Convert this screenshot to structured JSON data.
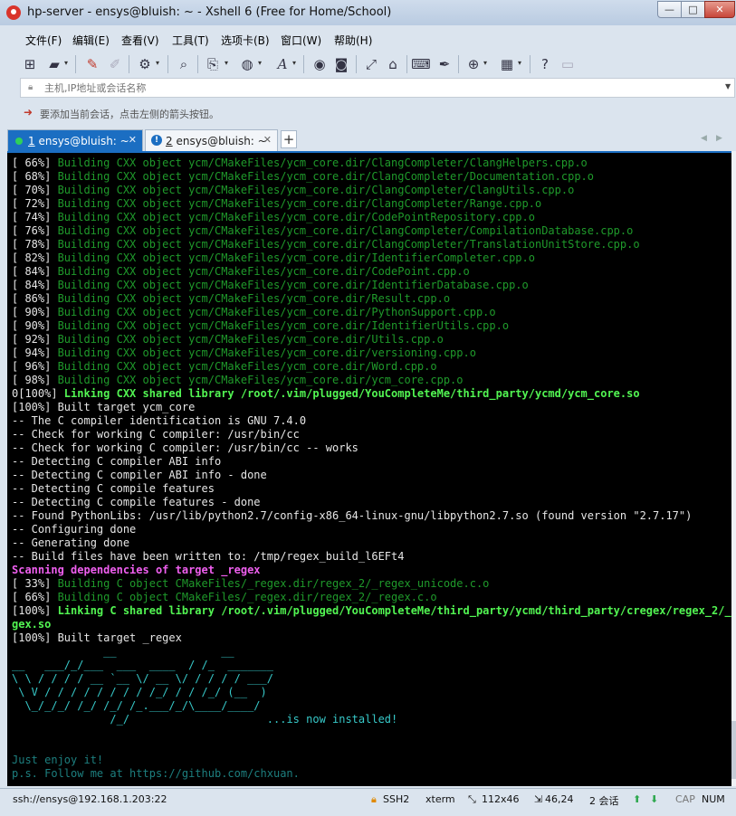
{
  "window": {
    "title": "hp-server - ensys@bluish: ~ - Xshell 6 (Free for Home/School)",
    "controls": {
      "minimize": "—",
      "maximize": "□",
      "close": "✕"
    }
  },
  "menu": [
    "文件(F)",
    "编辑(E)",
    "查看(V)",
    "工具(T)",
    "选项卡(B)",
    "窗口(W)",
    "帮助(H)"
  ],
  "toolbar_icons": [
    "new-session-icon",
    "open-folder-icon",
    "reconnect-icon",
    "disconnect-icon",
    "properties-icon",
    "find-icon",
    "transfer-icon",
    "globe-icon",
    "font-icon",
    "xftp-icon",
    "xmanager-icon",
    "fullscreen-icon",
    "lock-icon",
    "keyboard-icon",
    "highlight-icon",
    "add-tab-icon",
    "layout-icon",
    "help-icon",
    "chat-icon"
  ],
  "address": {
    "placeholder": "主机,IP地址或会话名称"
  },
  "hint": {
    "text": "要添加当前会话，点击左侧的箭头按钮。"
  },
  "tabs": [
    {
      "number": "1",
      "label": "ensys@bluish: ~",
      "active": true
    },
    {
      "number": "2",
      "label": "ensys@bluish: ~",
      "active": false
    }
  ],
  "terminal": {
    "lines": [
      {
        "segs": [
          {
            "t": "[ 66%] ",
            "c": "w"
          },
          {
            "t": "Building CXX object ycm/CMakeFiles/ycm_core.dir/ClangCompleter/ClangHelpers.cpp.o",
            "c": "g"
          }
        ]
      },
      {
        "segs": [
          {
            "t": "[ 68%] ",
            "c": "w"
          },
          {
            "t": "Building CXX object ycm/CMakeFiles/ycm_core.dir/ClangCompleter/Documentation.cpp.o",
            "c": "g"
          }
        ]
      },
      {
        "segs": [
          {
            "t": "[ 70%] ",
            "c": "w"
          },
          {
            "t": "Building CXX object ycm/CMakeFiles/ycm_core.dir/ClangCompleter/ClangUtils.cpp.o",
            "c": "g"
          }
        ]
      },
      {
        "segs": [
          {
            "t": "[ 72%] ",
            "c": "w"
          },
          {
            "t": "Building CXX object ycm/CMakeFiles/ycm_core.dir/ClangCompleter/Range.cpp.o",
            "c": "g"
          }
        ]
      },
      {
        "segs": [
          {
            "t": "[ 74%] ",
            "c": "w"
          },
          {
            "t": "Building CXX object ycm/CMakeFiles/ycm_core.dir/CodePointRepository.cpp.o",
            "c": "g"
          }
        ]
      },
      {
        "segs": [
          {
            "t": "[ 76%] ",
            "c": "w"
          },
          {
            "t": "Building CXX object ycm/CMakeFiles/ycm_core.dir/ClangCompleter/CompilationDatabase.cpp.o",
            "c": "g"
          }
        ]
      },
      {
        "segs": [
          {
            "t": "[ 78%] ",
            "c": "w"
          },
          {
            "t": "Building CXX object ycm/CMakeFiles/ycm_core.dir/ClangCompleter/TranslationUnitStore.cpp.o",
            "c": "g"
          }
        ]
      },
      {
        "segs": [
          {
            "t": "[ 82%] ",
            "c": "w"
          },
          {
            "t": "Building CXX object ycm/CMakeFiles/ycm_core.dir/IdentifierCompleter.cpp.o",
            "c": "g"
          }
        ]
      },
      {
        "segs": [
          {
            "t": "[ 84%] ",
            "c": "w"
          },
          {
            "t": "Building CXX object ycm/CMakeFiles/ycm_core.dir/CodePoint.cpp.o",
            "c": "g"
          }
        ]
      },
      {
        "segs": [
          {
            "t": "[ 84%] ",
            "c": "w"
          },
          {
            "t": "Building CXX object ycm/CMakeFiles/ycm_core.dir/IdentifierDatabase.cpp.o",
            "c": "g"
          }
        ]
      },
      {
        "segs": [
          {
            "t": "[ 86%] ",
            "c": "w"
          },
          {
            "t": "Building CXX object ycm/CMakeFiles/ycm_core.dir/Result.cpp.o",
            "c": "g"
          }
        ]
      },
      {
        "segs": [
          {
            "t": "[ 90%] ",
            "c": "w"
          },
          {
            "t": "Building CXX object ycm/CMakeFiles/ycm_core.dir/PythonSupport.cpp.o",
            "c": "g"
          }
        ]
      },
      {
        "segs": [
          {
            "t": "[ 90%] ",
            "c": "w"
          },
          {
            "t": "Building CXX object ycm/CMakeFiles/ycm_core.dir/IdentifierUtils.cpp.o",
            "c": "g"
          }
        ]
      },
      {
        "segs": [
          {
            "t": "[ 92%] ",
            "c": "w"
          },
          {
            "t": "Building CXX object ycm/CMakeFiles/ycm_core.dir/Utils.cpp.o",
            "c": "g"
          }
        ]
      },
      {
        "segs": [
          {
            "t": "[ 94%] ",
            "c": "w"
          },
          {
            "t": "Building CXX object ycm/CMakeFiles/ycm_core.dir/versioning.cpp.o",
            "c": "g"
          }
        ]
      },
      {
        "segs": [
          {
            "t": "[ 96%] ",
            "c": "w"
          },
          {
            "t": "Building CXX object ycm/CMakeFiles/ycm_core.dir/Word.cpp.o",
            "c": "g"
          }
        ]
      },
      {
        "segs": [
          {
            "t": "[ 98%] ",
            "c": "w"
          },
          {
            "t": "Building CXX object ycm/CMakeFiles/ycm_core.dir/ycm_core.cpp.o",
            "c": "g"
          }
        ]
      },
      {
        "segs": [
          {
            "t": "0[100%] ",
            "c": "w"
          },
          {
            "t": "Linking CXX shared library /root/.vim/plugged/YouCompleteMe/third_party/ycmd/ycm_core.so",
            "c": "bg"
          }
        ]
      },
      {
        "segs": [
          {
            "t": "[100%] Built target ycm_core",
            "c": "w"
          }
        ]
      },
      {
        "segs": [
          {
            "t": "-- The C compiler identification is GNU 7.4.0",
            "c": "w"
          }
        ]
      },
      {
        "segs": [
          {
            "t": "-- Check for working C compiler: /usr/bin/cc",
            "c": "w"
          }
        ]
      },
      {
        "segs": [
          {
            "t": "-- Check for working C compiler: /usr/bin/cc -- works",
            "c": "w"
          }
        ]
      },
      {
        "segs": [
          {
            "t": "-- Detecting C compiler ABI info",
            "c": "w"
          }
        ]
      },
      {
        "segs": [
          {
            "t": "-- Detecting C compiler ABI info - done",
            "c": "w"
          }
        ]
      },
      {
        "segs": [
          {
            "t": "-- Detecting C compile features",
            "c": "w"
          }
        ]
      },
      {
        "segs": [
          {
            "t": "-- Detecting C compile features - done",
            "c": "w"
          }
        ]
      },
      {
        "segs": [
          {
            "t": "-- Found PythonLibs: /usr/lib/python2.7/config-x86_64-linux-gnu/libpython2.7.so (found version \"2.7.17\")",
            "c": "w"
          }
        ]
      },
      {
        "segs": [
          {
            "t": "-- Configuring done",
            "c": "w"
          }
        ]
      },
      {
        "segs": [
          {
            "t": "-- Generating done",
            "c": "w"
          }
        ]
      },
      {
        "segs": [
          {
            "t": "-- Build files have been written to: /tmp/regex_build_l6EFt4",
            "c": "w"
          }
        ]
      },
      {
        "segs": [
          {
            "t": "Scanning dependencies of target _regex",
            "c": "m"
          }
        ]
      },
      {
        "segs": [
          {
            "t": "[ 33%] ",
            "c": "w"
          },
          {
            "t": "Building C object CMakeFiles/_regex.dir/regex_2/_regex_unicode.c.o",
            "c": "g"
          }
        ]
      },
      {
        "segs": [
          {
            "t": "[ 66%] ",
            "c": "w"
          },
          {
            "t": "Building C object CMakeFiles/_regex.dir/regex_2/_regex.c.o",
            "c": "g"
          }
        ]
      },
      {
        "segs": [
          {
            "t": "[100%] ",
            "c": "w"
          },
          {
            "t": "Linking C shared library /root/.vim/plugged/YouCompleteMe/third_party/ycmd/third_party/cregex/regex_2/_re",
            "c": "bg"
          }
        ]
      },
      {
        "segs": [
          {
            "t": "gex.so",
            "c": "bg"
          }
        ]
      },
      {
        "segs": [
          {
            "t": "[100%] Built target _regex",
            "c": "w"
          }
        ]
      },
      {
        "segs": [
          {
            "t": "              __                __",
            "c": "c"
          }
        ]
      },
      {
        "segs": [
          {
            "t": "__   ___/_/___  ___  ____  / /_  _______",
            "c": "c"
          }
        ]
      },
      {
        "segs": [
          {
            "t": "\\ \\ / / / / __ `__ \\/ __ \\/ / / / / ___/",
            "c": "c"
          }
        ]
      },
      {
        "segs": [
          {
            "t": " \\ V / / / / / / / / /_/ / / /_/ (__  )",
            "c": "c"
          }
        ]
      },
      {
        "segs": [
          {
            "t": "  \\_/_/_/ /_/ /_/ /_.___/_/\\____/____/",
            "c": "c"
          }
        ]
      },
      {
        "segs": [
          {
            "t": "               /_/                     ",
            "c": "c"
          },
          {
            "t": "...is now installed!",
            "c": "c"
          }
        ]
      },
      {
        "segs": [
          {
            "t": "",
            "c": "w"
          }
        ]
      },
      {
        "segs": [
          {
            "t": "",
            "c": "w"
          }
        ]
      },
      {
        "segs": [
          {
            "t": "Just enjoy it!",
            "c": "dc"
          }
        ]
      },
      {
        "segs": [
          {
            "t": "p.s. Follow me at https://github.com/chxuan.",
            "c": "dc"
          }
        ]
      }
    ]
  },
  "status": {
    "connection": "ssh://ensys@192.168.1.203:22",
    "protocol": "SSH2",
    "term": "xterm",
    "size": "112x46",
    "cursor": "46,24",
    "sessions": "2 会话",
    "caps": "CAP",
    "num": "NUM"
  },
  "colors": {
    "accent": "#1b6ec2",
    "terminal_bg": "#000000",
    "build_green": "#1f9a2b",
    "link_green": "#52f552",
    "scan_magenta": "#ef5fef",
    "banner_cyan": "#37c9c9"
  }
}
